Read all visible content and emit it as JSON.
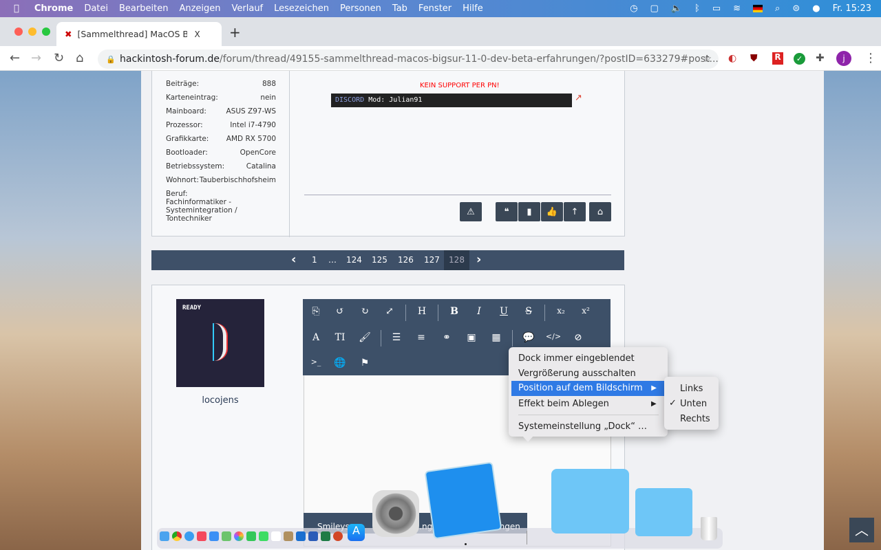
{
  "menubar": {
    "app": "Chrome",
    "items": [
      "Datei",
      "Bearbeiten",
      "Anzeigen",
      "Verlauf",
      "Lesezeichen",
      "Personen",
      "Tab",
      "Fenster",
      "Hilfe"
    ],
    "clock": "Fr. 15:23"
  },
  "browser": {
    "tab_title": "[Sammelthread] MacOS BigSur",
    "tab_close": "X",
    "new_tab": "+",
    "url_domain": "hackintosh-forum.de",
    "url_path": "/forum/thread/49155-sammelthread-macos-bigsur-11-0-dev-beta-erfahrungen/?postID=633279#post...",
    "profile_initial": "j"
  },
  "post1": {
    "profile": [
      {
        "label": "Beiträge:",
        "value": "888"
      },
      {
        "label": "Karteneintrag:",
        "value": "nein"
      },
      {
        "label": "Mainboard:",
        "value": "ASUS Z97-WS"
      },
      {
        "label": "Prozessor:",
        "value": "Intel i7-4790"
      },
      {
        "label": "Grafikkarte:",
        "value": "AMD RX 5700"
      },
      {
        "label": "Bootloader:",
        "value": "OpenCore"
      },
      {
        "label": "Betriebssystem:",
        "value": "Catalina"
      },
      {
        "label": "Wohnort:",
        "value": "Tauberbischhofsheim"
      }
    ],
    "beruf_label": "Beruf:",
    "beruf_value": "Fachinformatiker - Systemintegration / Tontechniker",
    "signature_warning": "KEIN SUPPORT PER PN!",
    "discord_label": "DISCORD",
    "discord_text": "Mod: Julian91"
  },
  "pagination": {
    "pages": [
      "1",
      "…",
      "124",
      "125",
      "126",
      "127",
      "128"
    ],
    "current": "128"
  },
  "post2": {
    "avatar_text": "READY",
    "username": "locojens",
    "tabs": [
      "Smileys",
      "…nge",
      "…ungen"
    ]
  },
  "toolbar_icons": [
    "source",
    "undo",
    "redo",
    "fullscreen",
    "heading",
    "bold",
    "italic",
    "underline",
    "strike",
    "subscript",
    "superscript",
    "font",
    "size",
    "paint",
    "list",
    "align",
    "link",
    "image",
    "table",
    "quote",
    "code",
    "spoiler",
    "terminal",
    "globe",
    "flag"
  ],
  "toolbar_glyphs": {
    "heading": "H",
    "bold": "B",
    "italic": "I",
    "underline": "U",
    "strike": "S",
    "sub": "x₂",
    "sup": "x²",
    "font": "A",
    "size": "TI"
  },
  "context_menu": {
    "items": [
      "Dock immer eingeblendet",
      "Vergrößerung ausschalten",
      "Position auf dem Bildschirm",
      "Effekt beim Ablegen",
      "Systemeinstellung „Dock“ …"
    ],
    "highlighted": "Position auf dem Bildschirm",
    "submenu": [
      "Links",
      "Unten",
      "Rechts"
    ],
    "checked": "Unten"
  },
  "colors": {
    "toolbar": "#3d5068",
    "highlight": "#2f7ae5",
    "warning": "#ff0000"
  }
}
